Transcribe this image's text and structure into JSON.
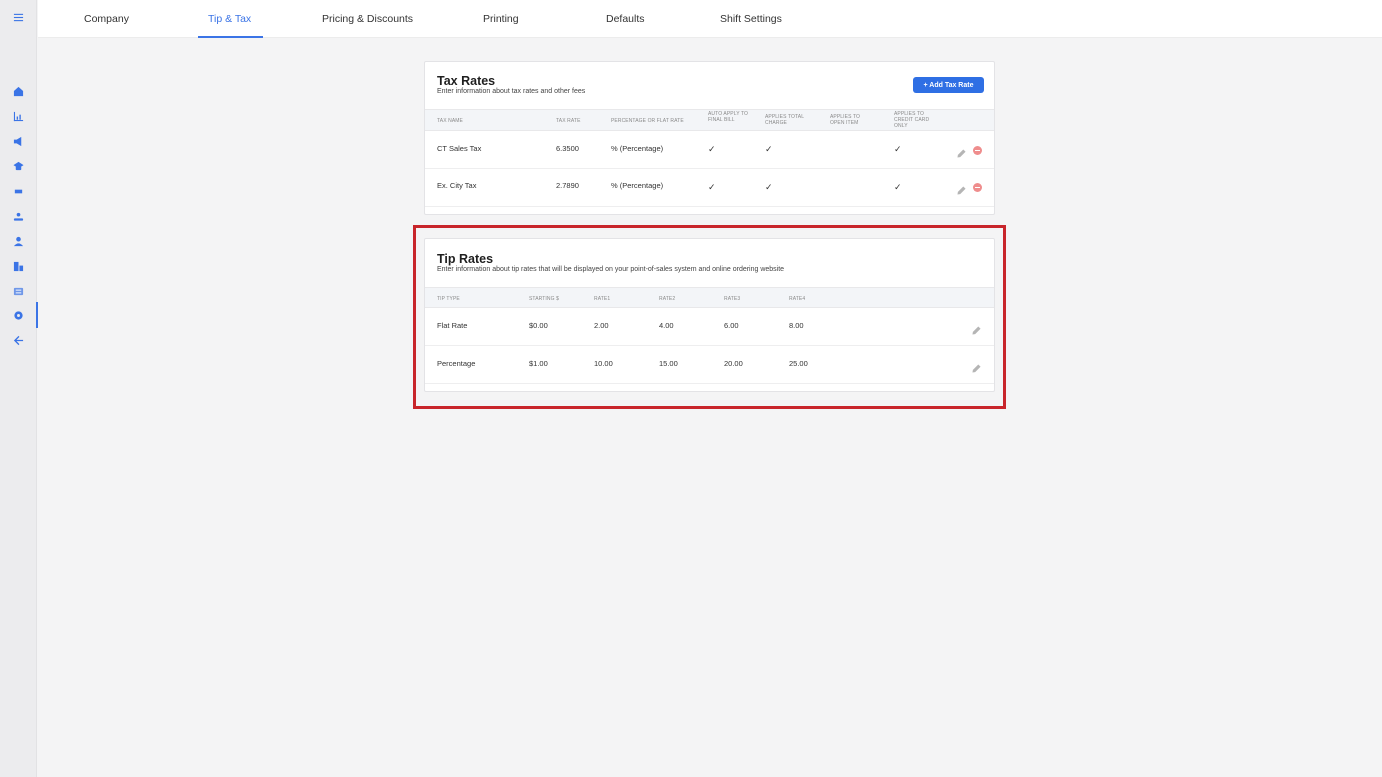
{
  "nav": {
    "tabs": [
      {
        "label": "Company"
      },
      {
        "label": "Tip & Tax"
      },
      {
        "label": "Pricing & Discounts"
      },
      {
        "label": "Printing"
      },
      {
        "label": "Defaults"
      },
      {
        "label": "Shift Settings"
      }
    ],
    "active_tab": "Tip & Tax"
  },
  "sidebar": {
    "icons": [
      "menu-icon",
      "home-icon",
      "chart-icon",
      "megaphone-icon",
      "graduation-cap-icon",
      "tag-icon",
      "users-icon",
      "user-icon",
      "building-icon",
      "list-icon",
      "gear-icon",
      "arrow-left-icon"
    ],
    "active": "gear-icon",
    "accent_color": "#3b74e6"
  },
  "tax_rates": {
    "title": "Tax Rates",
    "subtitle": "Enter information about tax rates and other fees",
    "add_button": "+ Add Tax Rate",
    "columns": [
      "TAX NAME",
      "TAX RATE",
      "PERCENTAGE OR FLAT RATE",
      "AUTO APPLY TO FINAL BILL",
      "APPLIES TOTAL CHARGE",
      "APPLIES TO OPEN ITEM",
      "APPLIES TO CREDIT CARD ONLY"
    ],
    "rows": [
      {
        "name": "CT Sales Tax",
        "rate": "6.3500",
        "type": "% (Percentage)",
        "auto_apply": true,
        "total_charge": true,
        "open_item": false,
        "credit_card": true
      },
      {
        "name": "Ex. City Tax",
        "rate": "2.7890",
        "type": "% (Percentage)",
        "auto_apply": true,
        "total_charge": true,
        "open_item": false,
        "credit_card": true
      }
    ],
    "check_glyph": "✓"
  },
  "tip_rates": {
    "title": "Tip Rates",
    "subtitle": "Enter information about tip rates that will be displayed on your point-of-sales system and online ordering website",
    "columns": [
      "TIP TYPE",
      "STARTING $",
      "RATE1",
      "RATE2",
      "RATE3",
      "RATE4"
    ],
    "rows": [
      {
        "type": "Flat Rate",
        "starting": "$0.00",
        "rate1": "2.00",
        "rate2": "4.00",
        "rate3": "6.00",
        "rate4": "8.00"
      },
      {
        "type": "Percentage",
        "starting": "$1.00",
        "rate1": "10.00",
        "rate2": "15.00",
        "rate3": "20.00",
        "rate4": "25.00"
      }
    ]
  },
  "colors": {
    "highlight": "#c8252b",
    "button": "#2f6fe4",
    "delete": "#ef8d8d"
  }
}
